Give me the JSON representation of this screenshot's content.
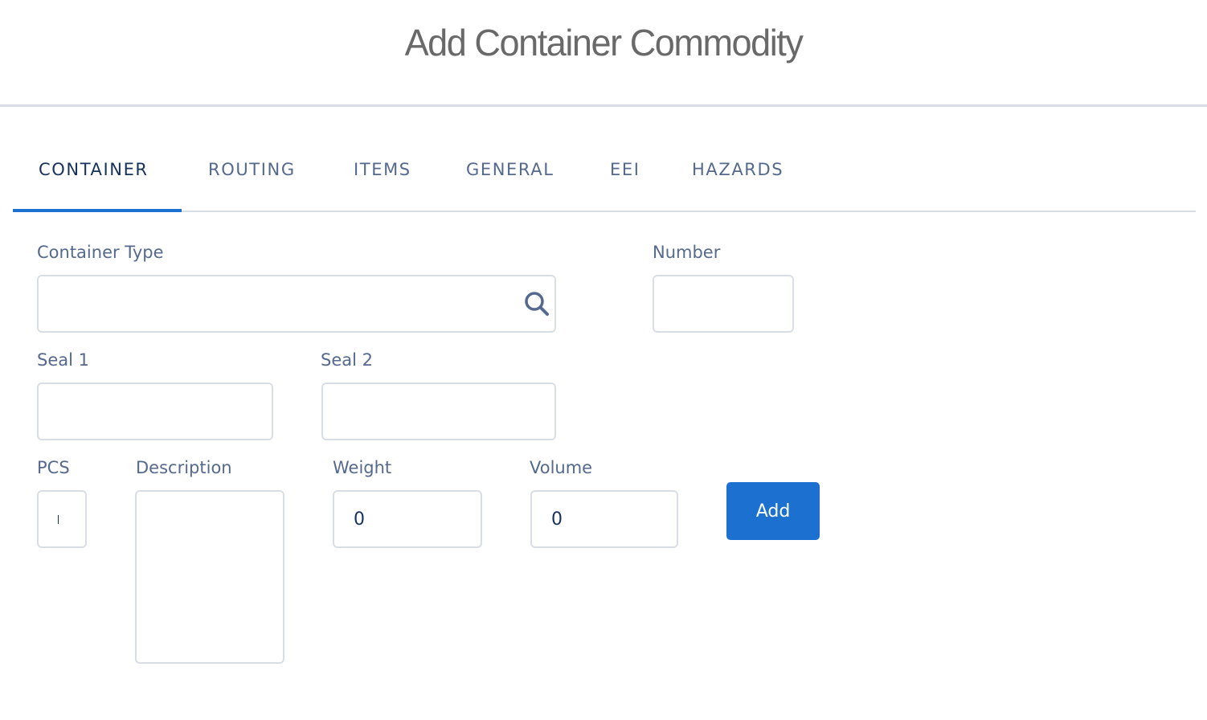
{
  "header": {
    "title": "Add Container Commodity"
  },
  "tabs": [
    {
      "label": "CONTAINER",
      "active": true
    },
    {
      "label": "ROUTING",
      "active": false
    },
    {
      "label": "ITEMS",
      "active": false
    },
    {
      "label": "GENERAL",
      "active": false
    },
    {
      "label": "EEI",
      "active": false
    },
    {
      "label": "HAZARDS",
      "active": false
    }
  ],
  "form": {
    "container_type": {
      "label": "Container Type",
      "value": "",
      "icon": "search-icon"
    },
    "number": {
      "label": "Number",
      "value": ""
    },
    "seal1": {
      "label": "Seal 1",
      "value": ""
    },
    "seal2": {
      "label": "Seal 2",
      "value": ""
    },
    "pcs": {
      "label": "PCS",
      "value": ""
    },
    "description": {
      "label": "Description",
      "value": ""
    },
    "weight": {
      "label": "Weight",
      "value": "0"
    },
    "volume": {
      "label": "Volume",
      "value": "0"
    },
    "add_button_label": "Add"
  },
  "colors": {
    "accent": "#1b70d0",
    "label_text": "#54698d",
    "active_tab_text": "#16325c",
    "border": "#d8dde6",
    "title_text": "#696969"
  }
}
